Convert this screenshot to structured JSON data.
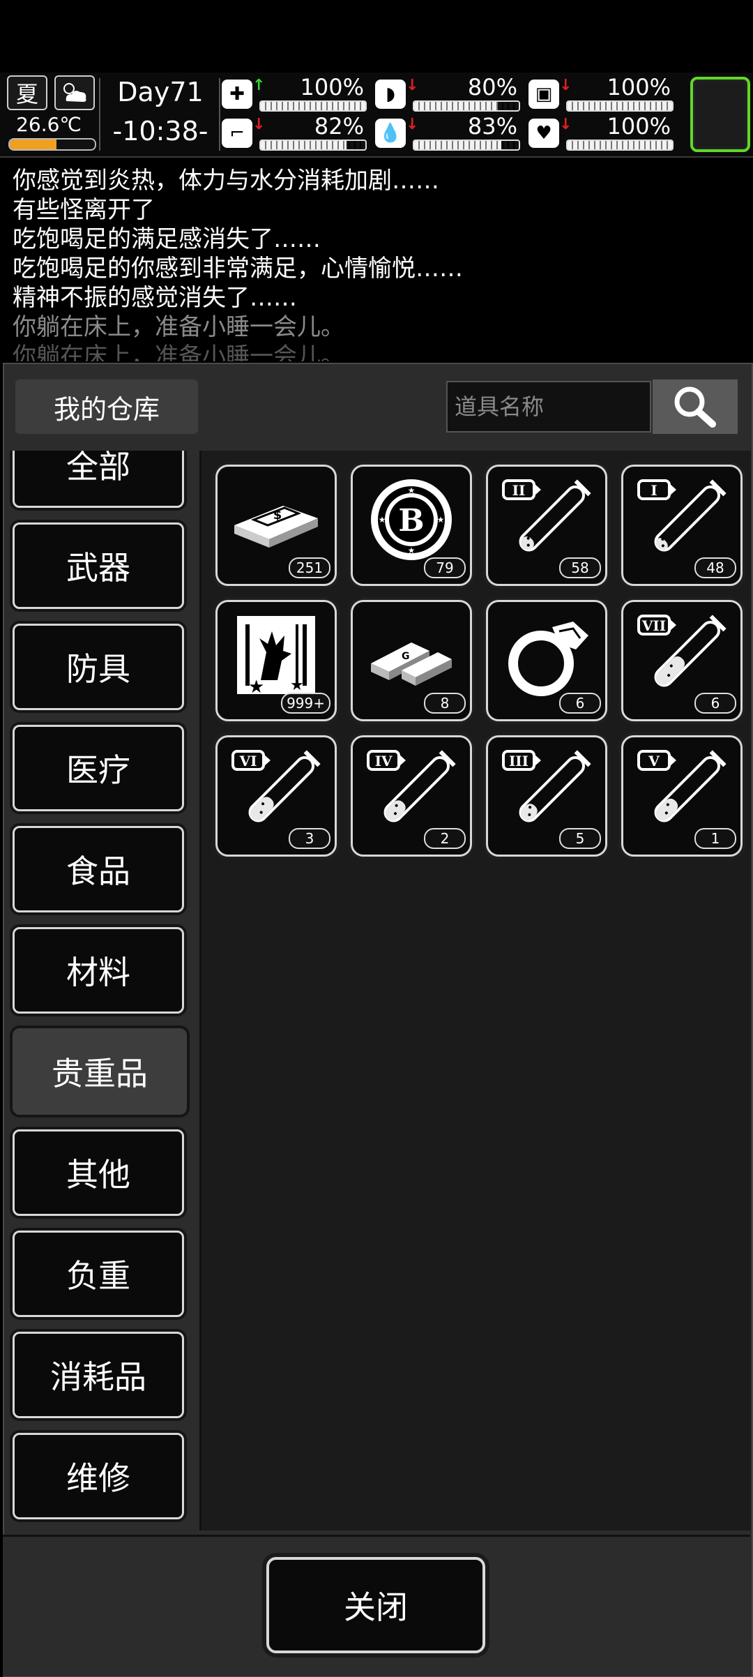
{
  "hud": {
    "season": "夏",
    "temperature": "26.6℃",
    "temperature_level": 0.55,
    "day": "Day71",
    "clock": "-10:38-",
    "stats": [
      {
        "icon": "medkit-icon",
        "trend": "up",
        "value": "100%",
        "level": 1.0
      },
      {
        "icon": "stomach-icon",
        "trend": "down",
        "value": "80%",
        "level": 0.8
      },
      {
        "icon": "battery-icon",
        "trend": "down",
        "value": "100%",
        "level": 1.0
      },
      {
        "icon": "boot-icon",
        "trend": "down",
        "value": "82%",
        "level": 0.82
      },
      {
        "icon": "water-drop-icon",
        "trend": "down",
        "value": "83%",
        "level": 0.83
      },
      {
        "icon": "heart-icon",
        "trend": "down",
        "value": "100%",
        "level": 1.0
      }
    ],
    "colors": {
      "up": "#35d435",
      "down": "#e02020",
      "slot_border": "#5fd82a",
      "temp_bar": "#f0a020"
    }
  },
  "log": [
    "你感觉到炎热，体力与水分消耗加剧……",
    "有些怪离开了",
    "吃饱喝足的满足感消失了……",
    "吃饱喝足的你感到非常满足，心情愉悦……",
    "精神不振的感觉消失了……",
    "你躺在床上，准备小睡一会儿。",
    "你躺在床上，准备小睡一会儿。"
  ],
  "storage": {
    "title": "我的仓库",
    "search_placeholder": "道具名称",
    "close_label": "关闭"
  },
  "categories": [
    "全部",
    "武器",
    "防具",
    "医疗",
    "食品",
    "材料",
    "贵重品",
    "其他",
    "负重",
    "消耗品",
    "维修"
  ],
  "active_category": "贵重品",
  "items": [
    {
      "icon": "cash-stack-icon",
      "count": "251"
    },
    {
      "icon": "b-coin-icon",
      "count": "79"
    },
    {
      "icon": "test-tube-II-icon",
      "roman": "II",
      "count": "58",
      "fill": 0.25
    },
    {
      "icon": "test-tube-I-icon",
      "roman": "I",
      "count": "48",
      "fill": 0.2
    },
    {
      "icon": "card-icon",
      "count": "999+"
    },
    {
      "icon": "gold-bars-icon",
      "count": "8"
    },
    {
      "icon": "ring-icon",
      "count": "6"
    },
    {
      "icon": "test-tube-VII-icon",
      "roman": "VII",
      "count": "6",
      "fill": 0.7
    },
    {
      "icon": "test-tube-VI-icon",
      "roman": "VI",
      "count": "3",
      "fill": 0.55
    },
    {
      "icon": "test-tube-IV-icon",
      "roman": "IV",
      "count": "2",
      "fill": 0.45
    },
    {
      "icon": "test-tube-III-icon",
      "roman": "III",
      "count": "5",
      "fill": 0.35
    },
    {
      "icon": "test-tube-V-icon",
      "roman": "V",
      "count": "1",
      "fill": 0.5
    }
  ]
}
